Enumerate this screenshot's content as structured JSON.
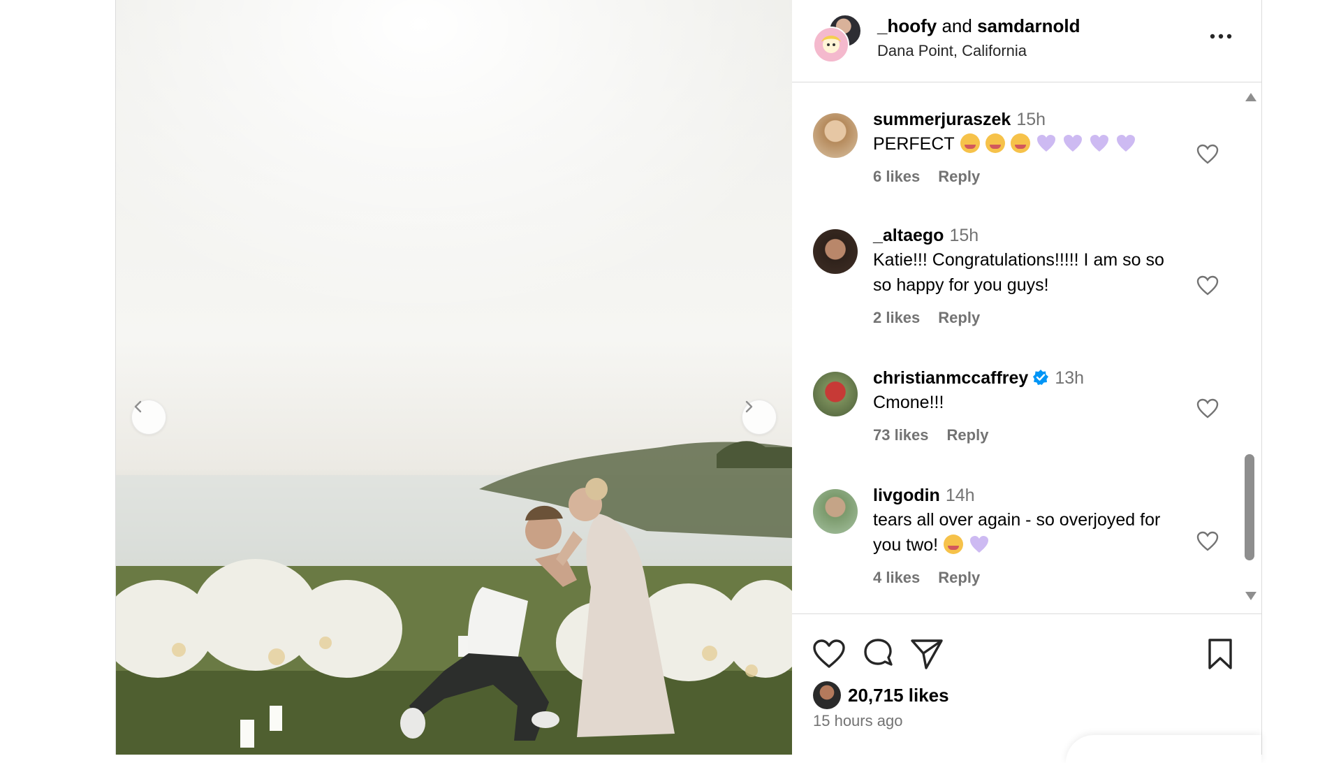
{
  "post": {
    "user1": "_hoofy",
    "joiner": "and",
    "user2": "samdarnold",
    "location": "Dana Point, California"
  },
  "comments": [
    {
      "user": "summerjuraszek",
      "time": "15h",
      "text": "PERFECT",
      "emoji": [
        "crying-face",
        "crying-face",
        "crying-face",
        "purple-heart",
        "purple-heart",
        "purple-heart",
        "purple-heart"
      ],
      "likes": "6 likes",
      "reply": "Reply"
    },
    {
      "user": "_altaego",
      "time": "15h",
      "text": "Katie!!! Congratulations!!!!! I am so so so happy for you guys!",
      "likes": "2 likes",
      "reply": "Reply"
    },
    {
      "user": "christianmccaffrey",
      "time": "13h",
      "text": "Cmone!!!",
      "likes": "73 likes",
      "reply": "Reply",
      "verified": true
    },
    {
      "user": "livgodin",
      "time": "14h",
      "text": "tears all over again - so overjoyed for you two!",
      "emoji": [
        "crying-face",
        "purple-heart"
      ],
      "likes": "4 likes",
      "reply": "Reply"
    }
  ],
  "likes": "20,715 likes",
  "timestamp": "15 hours ago",
  "colors": {
    "border": "#dbdbdb",
    "muted": "#737373",
    "verified": "#0095f6",
    "emoji_heart": "#c9b6f0"
  }
}
